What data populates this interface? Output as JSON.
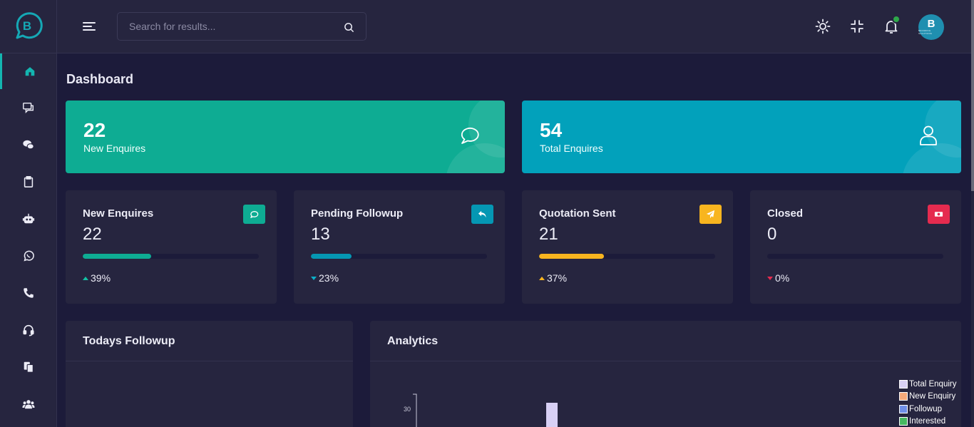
{
  "search": {
    "placeholder": "Search for results..."
  },
  "logo": {
    "letter": "B"
  },
  "avatar": {
    "letter": "B",
    "subtext": "BRANDING SOLUTIONS"
  },
  "page": {
    "title": "Dashboard"
  },
  "top_cards": [
    {
      "value": "22",
      "label": "New Enquires",
      "color": "#0eac93",
      "icon": "chat-bubble-icon"
    },
    {
      "value": "54",
      "label": "Total Enquires",
      "color": "#02a1bb",
      "icon": "user-icon"
    }
  ],
  "stat_cards": [
    {
      "title": "New Enquires",
      "value": "22",
      "percent": "39%",
      "progress": 0.39,
      "trend": "up",
      "color": "#0eac93",
      "trend_color": "#13c1a3",
      "icon": "message-icon"
    },
    {
      "title": "Pending Followup",
      "value": "13",
      "percent": "23%",
      "progress": 0.23,
      "trend": "down",
      "color": "#0597b3",
      "trend_color": "#0bb0c9",
      "icon": "reply-icon"
    },
    {
      "title": "Quotation Sent",
      "value": "21",
      "percent": "37%",
      "progress": 0.37,
      "trend": "up",
      "color": "#f8b51f",
      "trend_color": "#f8b51f",
      "icon": "send-icon"
    },
    {
      "title": "Closed",
      "value": "0",
      "percent": "0%",
      "progress": 0,
      "trend": "down",
      "color": "#e52b4f",
      "trend_color": "#e52b4f",
      "icon": "money-icon"
    }
  ],
  "panels": {
    "followup_title": "Todays Followup",
    "analytics_title": "Analytics"
  },
  "chart_data": {
    "type": "bar",
    "title": "",
    "xlabel": "",
    "ylabel": "",
    "y_ticks": [
      "30"
    ],
    "series": [
      {
        "name": "Total Enquiry",
        "color": "#d8d0f5",
        "values": [
          32
        ]
      },
      {
        "name": "New Enquiry",
        "color": "#f5a97a",
        "values": []
      },
      {
        "name": "Followup",
        "color": "#6f8fe8",
        "values": []
      },
      {
        "name": "Interested",
        "color": "#46b860",
        "values": []
      }
    ]
  }
}
